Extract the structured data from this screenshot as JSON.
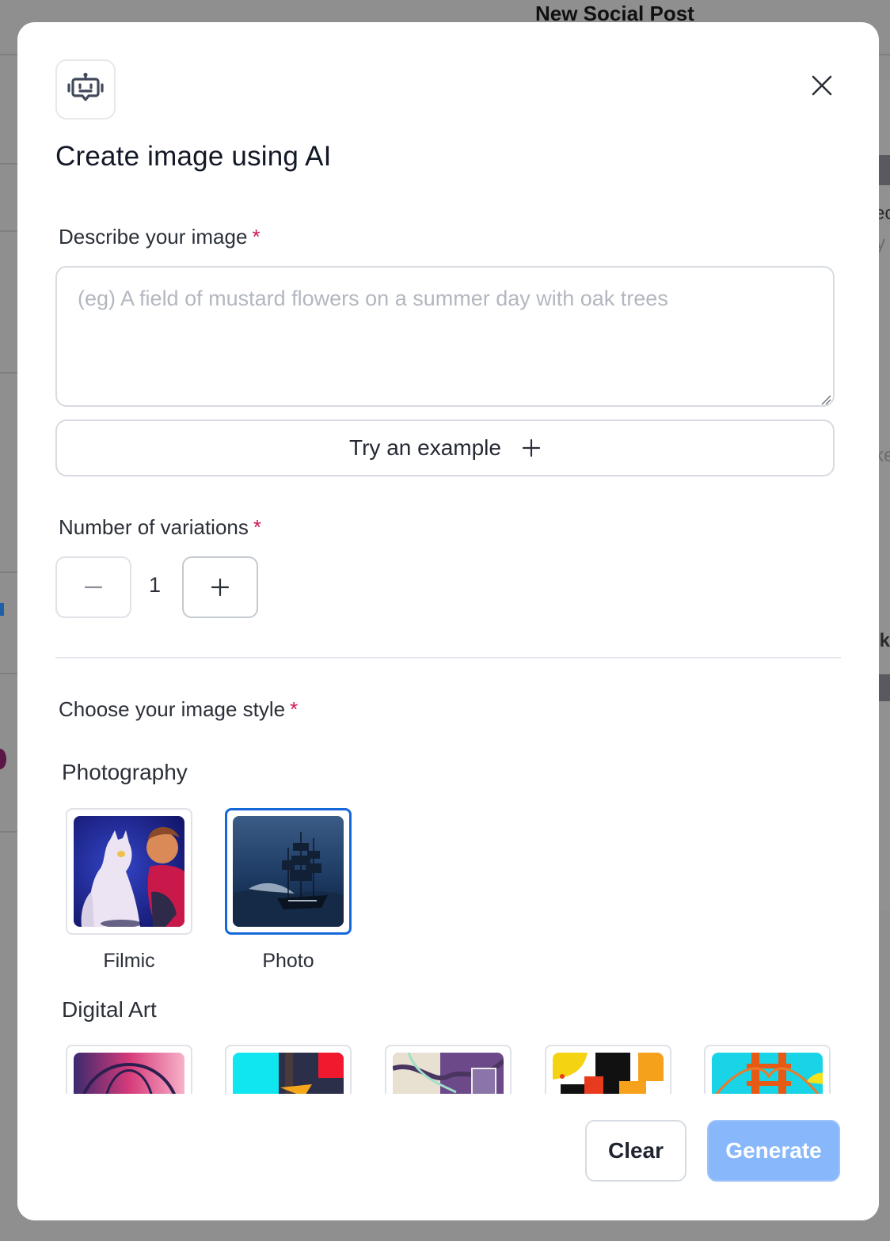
{
  "background": {
    "page_title": "New Social Post",
    "edge_texts": [
      "ec",
      "y",
      "ke",
      "ik"
    ]
  },
  "modal": {
    "title": "Create image using AI",
    "icon": "robot-icon",
    "close_icon": "close-icon",
    "prompt": {
      "label": "Describe your image",
      "required_mark": "*",
      "placeholder": "(eg) A field of mustard flowers on a summer day with oak trees",
      "value": ""
    },
    "example_button": {
      "label": "Try an example",
      "icon": "plus-icon"
    },
    "variations": {
      "label": "Number of variations",
      "required_mark": "*",
      "value": "1",
      "decrement_icon": "minus-icon",
      "increment_icon": "plus-icon"
    },
    "style": {
      "label": "Choose your image style",
      "required_mark": "*",
      "groups": [
        {
          "name": "Photography",
          "items": [
            {
              "name": "Filmic",
              "selected": false
            },
            {
              "name": "Photo",
              "selected": true
            }
          ]
        },
        {
          "name": "Digital Art",
          "items": [
            {
              "name": "",
              "selected": false
            },
            {
              "name": "",
              "selected": false
            },
            {
              "name": "",
              "selected": false
            },
            {
              "name": "",
              "selected": false
            },
            {
              "name": "",
              "selected": false
            }
          ]
        }
      ]
    },
    "footer": {
      "clear_label": "Clear",
      "generate_label": "Generate"
    }
  },
  "colors": {
    "accent": "#1468d8",
    "generate_disabled": "#88b8fb",
    "required": "#d0155a"
  }
}
